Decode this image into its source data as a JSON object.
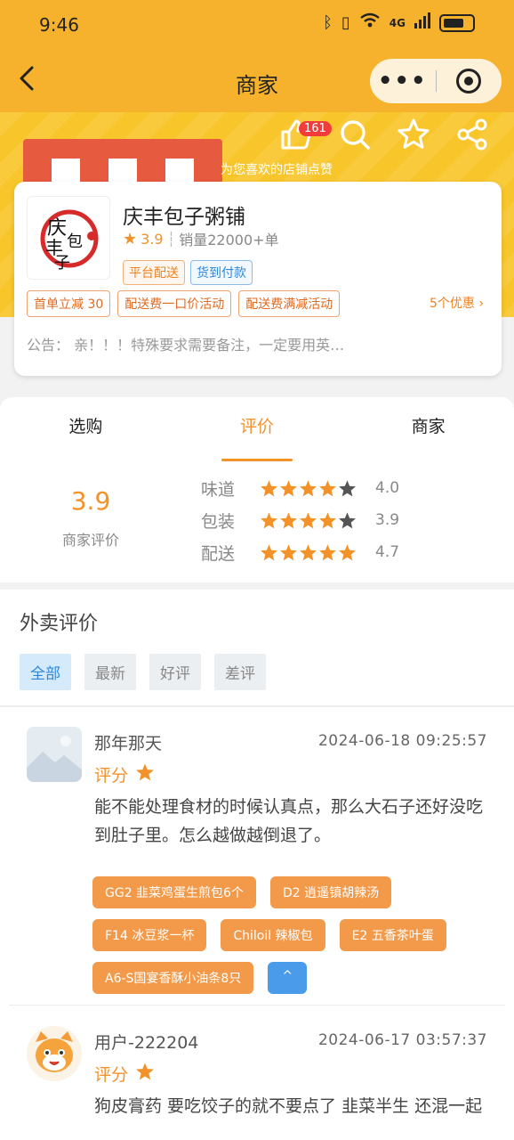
{
  "status_bar": {
    "time": "9:46",
    "icons": [
      "bluetooth-icon",
      "vibrate-icon",
      "wifi-icon",
      "signal-4g-icon",
      "battery-icon"
    ],
    "network_label": "4G"
  },
  "nav": {
    "title": "商家",
    "more_icon": "more-dots-icon",
    "close_icon": "target-icon"
  },
  "banner": {
    "like_count": "161",
    "like_hint": "为您喜欢的店铺点赞",
    "actions": [
      "thumbs-up-icon",
      "search-icon",
      "star-icon",
      "share-icon"
    ]
  },
  "shop": {
    "name": "庆丰包子粥铺",
    "score": "3.9",
    "sales": "销量22000+单",
    "tags": [
      "平台配送",
      "货到付款"
    ],
    "promos": [
      "首单立减 30",
      "配送费一口价活动",
      "配送费满减活动"
    ],
    "promo_more": "5个优惠",
    "notice_label": "公告：",
    "notice_text": "亲！！！特殊要求需要备注，一定要用英…"
  },
  "tabs": [
    "选购",
    "评价",
    "商家"
  ],
  "active_tab": 1,
  "rating": {
    "overall_score": "3.9",
    "overall_label": "商家评价",
    "items": [
      {
        "label": "味道",
        "stars": 4,
        "value": "4.0"
      },
      {
        "label": "包装",
        "stars": 4,
        "value": "3.9"
      },
      {
        "label": "配送",
        "stars": 5,
        "value": "4.7"
      }
    ]
  },
  "reviews_section": {
    "title": "外卖评价",
    "filters": [
      "全部",
      "最新",
      "好评",
      "差评"
    ],
    "active_filter": 0,
    "items": [
      {
        "user": "那年那天",
        "date": "2024-06-18 09:25:57",
        "rate_label": "评分",
        "stars": 1,
        "text": "能不能处理食材的时候认真点，那么大石子还好没吃到肚子里。怎么越做越倒退了。",
        "dishes": [
          "GG2 韭菜鸡蛋生煎包6个",
          "D2 逍遥镇胡辣汤",
          "F14 冰豆浆一杯",
          "Chiloil 辣椒包",
          "E2 五香茶叶蛋",
          "A6-S国宴香酥小油条8只"
        ],
        "collapse_label": "^"
      },
      {
        "user": "用户-222204",
        "date": "2024-06-17 03:57:37",
        "rate_label": "评分",
        "stars": 1,
        "text": "狗皮膏药 要吃饺子的就不要点了 韭菜半生 还混一起"
      }
    ]
  },
  "colors": {
    "brand_yellow": "#f6b22c",
    "accent_orange": "#f39228",
    "link_blue": "#2f87d9"
  }
}
